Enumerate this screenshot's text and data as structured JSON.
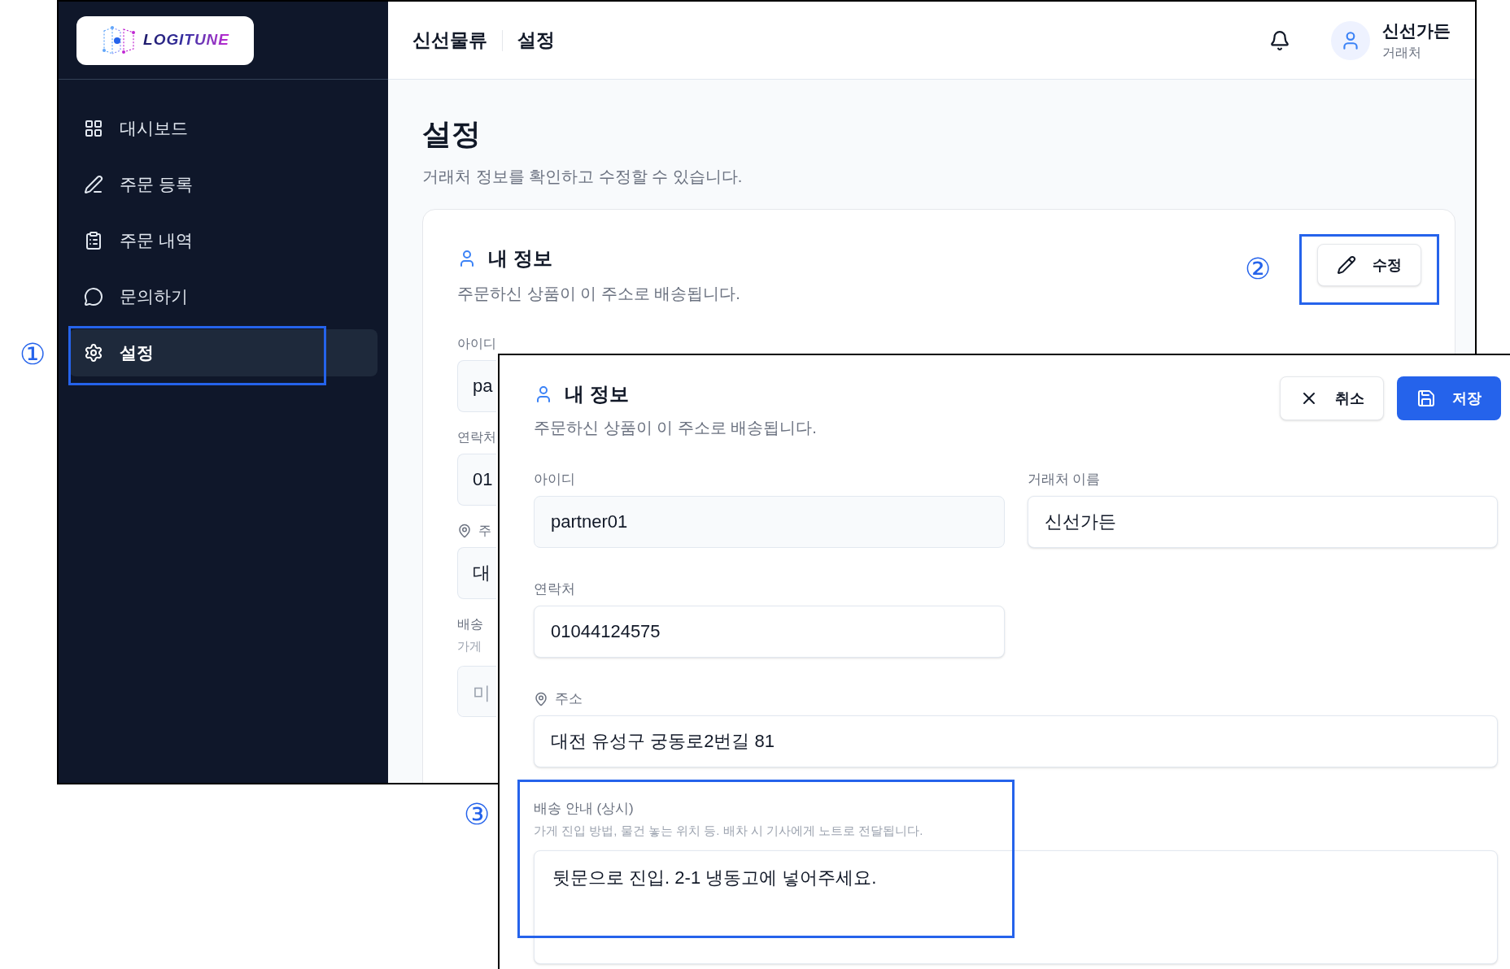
{
  "sidebar": {
    "logo": "LOGITUNE",
    "items": [
      {
        "label": "대시보드",
        "selected": false
      },
      {
        "label": "주문 등록",
        "selected": false
      },
      {
        "label": "주문 내역",
        "selected": false
      },
      {
        "label": "문의하기",
        "selected": false
      },
      {
        "label": "설정",
        "selected": true
      }
    ]
  },
  "header": {
    "breadcrumb": [
      "신선물류",
      "설정"
    ],
    "user": {
      "name": "신선가든",
      "role": "거래처"
    }
  },
  "page": {
    "title": "설정",
    "subtitle": "거래처 정보를 확인하고 수정할 수 있습니다."
  },
  "card": {
    "title": "내 정보",
    "subtitle": "주문하신 상품이 이 주소로 배송됩니다.",
    "edit_button": "수정",
    "fields": [
      {
        "kind": "text",
        "label": "아이디",
        "value": "pa",
        "disabled": true
      },
      {
        "kind": "text",
        "label": "연락처",
        "value": "01",
        "disabled": true
      },
      {
        "kind": "address",
        "label": "주",
        "value": "대",
        "disabled": true
      },
      {
        "kind": "note",
        "label": "배송",
        "hint": "가게",
        "placeholder": "미",
        "disabled": true
      }
    ]
  },
  "edit_panel": {
    "title": "내 정보",
    "subtitle": "주문하신 상품이 이 주소로 배송됩니다.",
    "cancel_button": "취소",
    "save_button": "저장",
    "fields": [
      {
        "kind": "text",
        "label": "아이디",
        "value": "partner01",
        "disabled": true
      },
      {
        "kind": "text",
        "label": "거래처 이름",
        "value": "신선가든",
        "disabled": false
      },
      {
        "kind": "text",
        "label": "연락처",
        "value": "01044124575",
        "disabled": false
      },
      {
        "kind": "address",
        "label": "주소",
        "value": "대전 유성구 궁동로2번길 81",
        "disabled": false
      },
      {
        "kind": "note",
        "label": "배송 안내 (상시)",
        "hint": "가게 진입 방법, 물건 놓는 위치 등. 배차 시 기사에게 노트로 전달됩니다.",
        "value": "뒷문으로 진입. 2-1 냉동고에 넣어주세요.",
        "disabled": false
      }
    ]
  },
  "annotations": [
    {
      "number": "①"
    },
    {
      "number": "②"
    },
    {
      "number": "③"
    }
  ]
}
